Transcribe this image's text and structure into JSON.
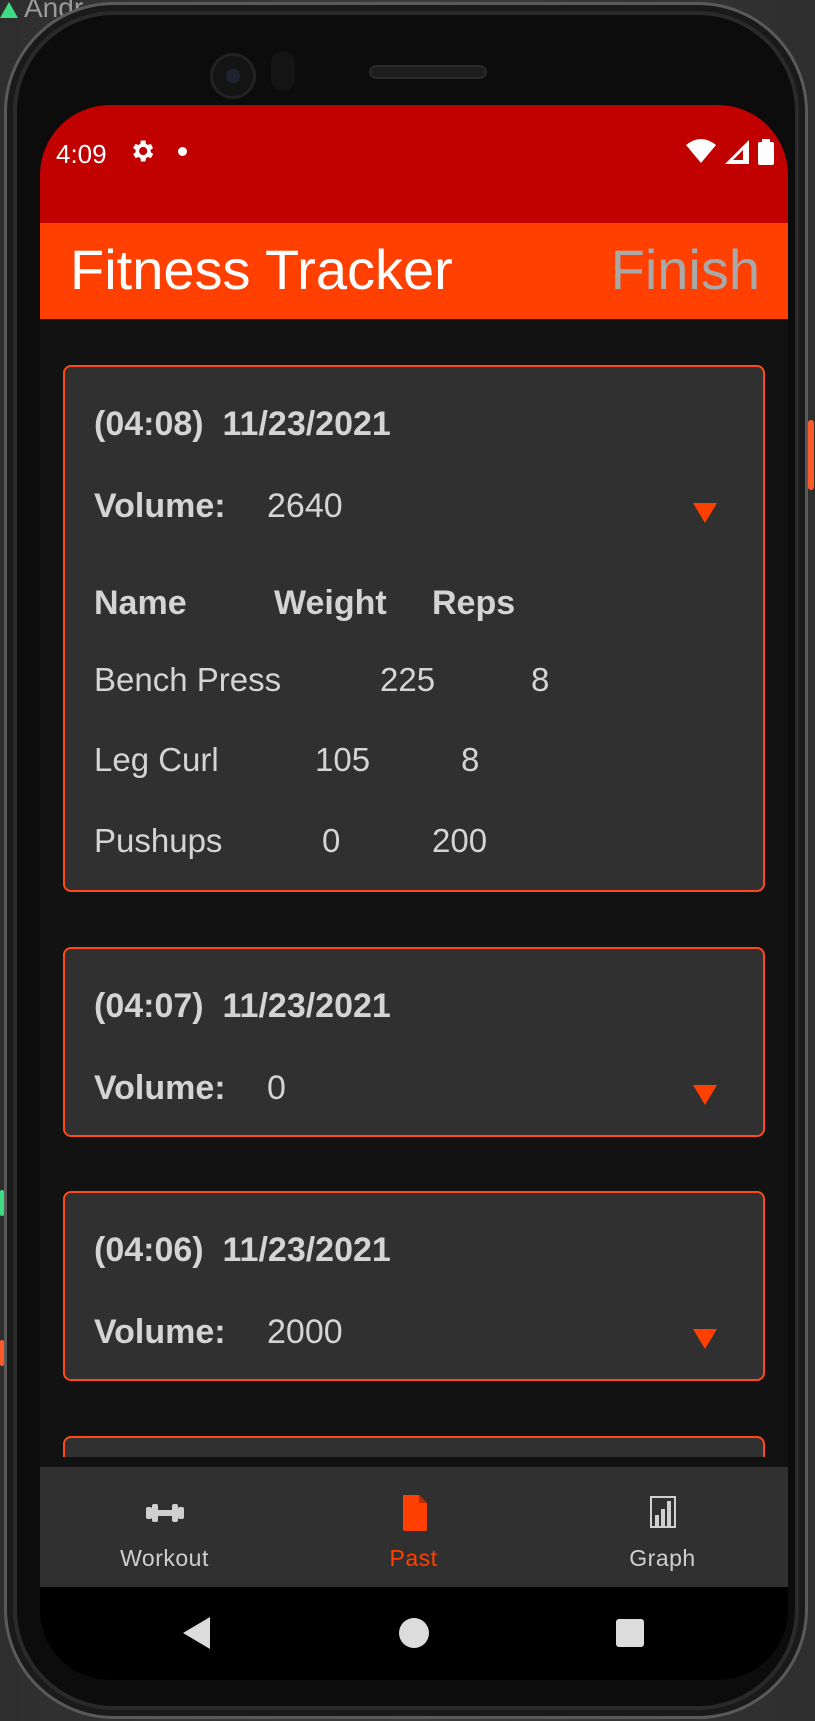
{
  "host": {
    "window_title": "Andr"
  },
  "status_bar": {
    "time": "4:09"
  },
  "app_bar": {
    "title": "Fitness Tracker",
    "action": "Finish"
  },
  "workouts": [
    {
      "time": "(04:08)",
      "date": "11/23/2021",
      "volume_label": "Volume:",
      "volume": "2640",
      "expanded": true,
      "columns": [
        "Name",
        "Weight",
        "Reps"
      ],
      "rows": [
        {
          "name": "Bench Press",
          "weight": "225",
          "reps": "8"
        },
        {
          "name": "Leg Curl",
          "weight": "105",
          "reps": "8"
        },
        {
          "name": "Pushups",
          "weight": "0",
          "reps": "200"
        }
      ]
    },
    {
      "time": "(04:07)",
      "date": "11/23/2021",
      "volume_label": "Volume:",
      "volume": "0",
      "expanded": false
    },
    {
      "time": "(04:06)",
      "date": "11/23/2021",
      "volume_label": "Volume:",
      "volume": "2000",
      "expanded": false
    }
  ],
  "bottom_nav": {
    "items": [
      {
        "label": "Workout",
        "icon": "dumbbell-icon",
        "active": false
      },
      {
        "label": "Past",
        "icon": "document-icon",
        "active": true
      },
      {
        "label": "Graph",
        "icon": "bar-chart-icon",
        "active": false
      }
    ]
  },
  "colors": {
    "status_bar": "#c10000",
    "app_bar": "#ff4000",
    "accent": "#ff4000",
    "card_bg": "#303030",
    "card_border": "#ff4a16",
    "inactive_nav": "#cfcfcf"
  }
}
